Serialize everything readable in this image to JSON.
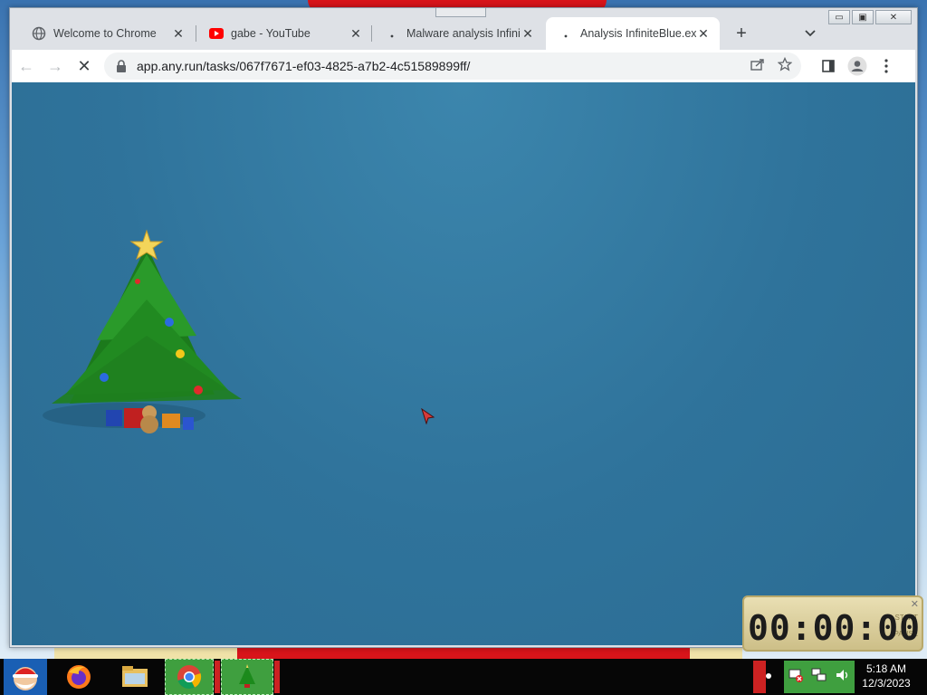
{
  "browser": {
    "tabs": [
      {
        "title": "Welcome to Chrome",
        "icon": "globe-icon",
        "active": false
      },
      {
        "title": "gabe - YouTube",
        "icon": "youtube-icon",
        "active": false
      },
      {
        "title": "Malware analysis Infinite",
        "icon": "loading-icon",
        "active": false
      },
      {
        "title": "Analysis InfiniteBlue.exe",
        "icon": "loading-icon",
        "active": true
      }
    ],
    "new_tab_symbol": "+",
    "tab_search_symbol": "⌄",
    "close_symbol": "✕",
    "nav": {
      "back": "←",
      "forward": "→",
      "reload": "✕"
    },
    "url": "app.any.run/tasks/067f7671-ef03-4825-a7b2-4c51589899ff/",
    "omnibox_icons": [
      "share-icon",
      "bookmark-star-icon"
    ],
    "toolbar_icons": [
      "side-panel-icon",
      "profile-icon",
      "menu-icon"
    ],
    "window_controls": [
      "▭",
      "▣",
      "✕"
    ]
  },
  "countdown": {
    "time": "00:00:00",
    "side_top": "START",
    "side_bottom": "PAUSE",
    "close": "✕"
  },
  "taskbar": {
    "apps": [
      "santa-start-icon",
      "firefox-icon",
      "file-explorer-icon",
      "chrome-icon",
      "christmas-tree-icon"
    ],
    "clock_time": "5:18 AM",
    "clock_date": "12/3/2023"
  },
  "colors": {
    "viewport_bg": "#2f739b",
    "taskbar_bg": "#060606",
    "running_app": "#3f9f3f"
  }
}
